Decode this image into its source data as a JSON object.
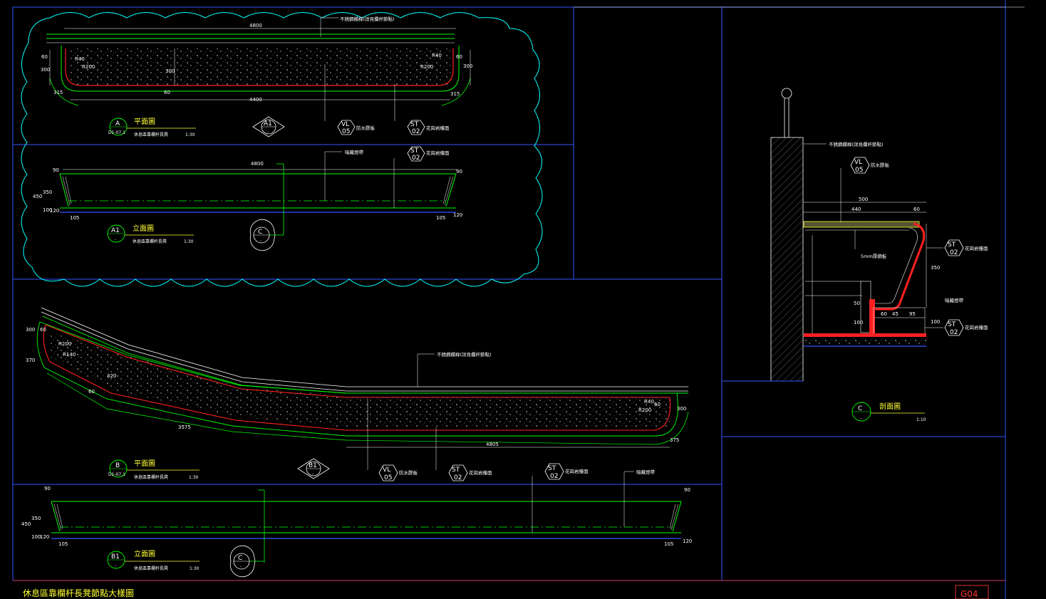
{
  "drawing": {
    "title": "休息區靠欄杆長凳節點大樣圖",
    "sheet_no": "G04"
  },
  "colors": {
    "background": "#000000",
    "frame": "#3355ff",
    "cloud": "#00ffff",
    "outline": "#00ff00",
    "cushion": "#ff2020",
    "title_text": "#ffff33",
    "sheet_box": "#ff3333"
  },
  "views": {
    "plan_a": {
      "id": "A",
      "sheet": "D1-07.1",
      "title": "平面圖",
      "subtitle": "休息區靠欄杆長凳",
      "scale": "1:30"
    },
    "elev_a1": {
      "id": "A1",
      "sheet": "-",
      "title": "立面圖",
      "subtitle": "休息區靠欄杆長凳",
      "scale": "1:30"
    },
    "plan_b": {
      "id": "B",
      "sheet": "D1-07.1",
      "title": "平面圖",
      "subtitle": "休息區靠欄杆長凳",
      "scale": "1:30"
    },
    "elev_b1": {
      "id": "B1",
      "sheet": "-",
      "title": "立面圖",
      "subtitle": "休息區靠欄杆長凳",
      "scale": "1:30"
    },
    "section_c": {
      "id": "C",
      "sheet": "-",
      "title": "剖面圖",
      "scale": "1:10"
    }
  },
  "markers": {
    "a1": {
      "id": "A1",
      "sheet": "-"
    },
    "b1": {
      "id": "B1",
      "sheet": "-"
    },
    "c": {
      "id": "C",
      "sheet": "-"
    }
  },
  "material_tags": {
    "vl05": {
      "code": "VL",
      "no": "05",
      "note": "防水膠板"
    },
    "st02": {
      "code": "ST",
      "no": "02",
      "note": "花崗岩檯面"
    }
  },
  "notes": {
    "rail": "不銹鋼欄桿(詳見欄杆節點)",
    "light": "暗藏燈帶",
    "plate": "5mm厚鋼板",
    "ledge": "暗藏燈帶"
  },
  "dims": {
    "d4800": "4800",
    "d4400": "4400",
    "d4805": "4805",
    "d3575": "3575",
    "d500": "500",
    "d440": "440",
    "d450": "450",
    "d350": "350",
    "d300": "300",
    "d200": "200",
    "d100": "100",
    "d105": "105",
    "d95": "95",
    "d90": "90",
    "d60": "60",
    "d45": "45",
    "d50": "50",
    "d120": "120",
    "d375": "375",
    "d370": "370",
    "d315": "315",
    "d320": "320",
    "r400": "R400",
    "r200": "R200",
    "r140": "R140",
    "r40": "R40"
  }
}
